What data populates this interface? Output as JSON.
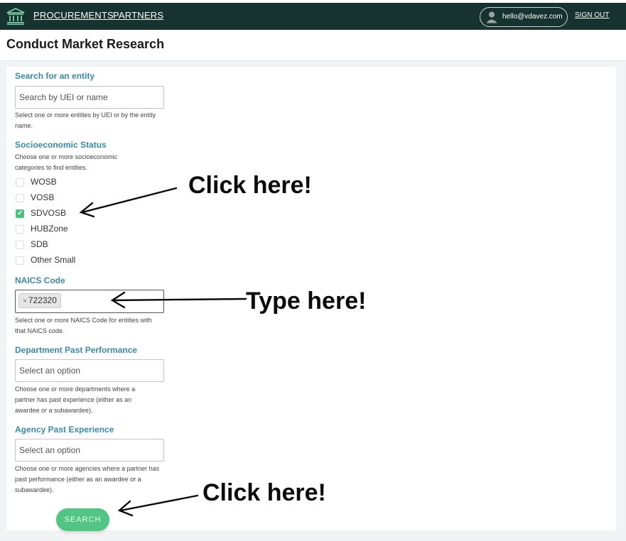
{
  "nav": {
    "procurements": "PROCUREMENTS",
    "partners": "PARTNERS",
    "user_email": "hello@vdavez.com",
    "sign_out": "SIGN OUT",
    "logo_icon": "courthouse-icon",
    "avatar_icon": "person-icon"
  },
  "page": {
    "title": "Conduct Market Research"
  },
  "form": {
    "entity": {
      "label": "Search for an entity",
      "placeholder": "Search by UEI or name",
      "help": "Select one or more entities by UEI or by the entity name."
    },
    "socioeconomic": {
      "label": "Socioeconomic Status",
      "help": "Choose one or more socioeconomic categories to find entities.",
      "options": [
        {
          "label": "WOSB",
          "checked": false
        },
        {
          "label": "VOSB",
          "checked": false
        },
        {
          "label": "SDVOSB",
          "checked": true
        },
        {
          "label": "HUBZone",
          "checked": false
        },
        {
          "label": "SDB",
          "checked": false
        },
        {
          "label": "Other Small",
          "checked": false
        }
      ]
    },
    "naics": {
      "label": "NAICS Code",
      "selected": "722320",
      "remove_glyph": "×",
      "help": "Select one or more NAICS Code for entities with that NAICS code."
    },
    "department": {
      "label": "Department Past Performance",
      "placeholder": "Select an option",
      "help": "Choose one or more departments where a partner has past experience (either as an awardee or a subawardee)."
    },
    "agency": {
      "label": "Agency Past Experience",
      "placeholder": "Select an option",
      "help": "Choose one or more agencies where a partner has past performance (either as an awardee or a subawardee)."
    },
    "search_button": "SEARCH"
  },
  "annotations": {
    "click_checkbox": "Click here!",
    "type_naics": "Type here!",
    "click_search": "Click here!"
  },
  "colors": {
    "topbar": "#17332f",
    "label": "#3a8aa8",
    "accent_green": "#52c584"
  }
}
